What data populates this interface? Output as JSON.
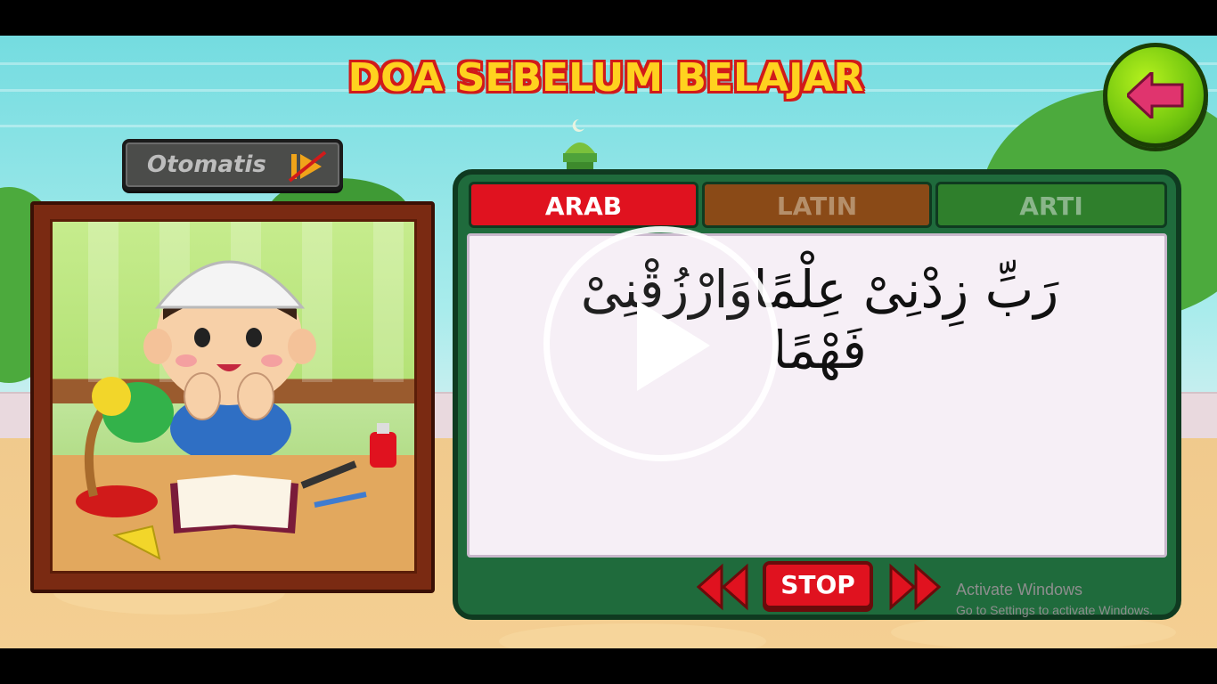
{
  "title": "DOA SEBELUM BELAJAR",
  "back_button": {
    "icon": "arrow-left-icon",
    "color": "#e0346e"
  },
  "otomatis_button": {
    "label": "Otomatis",
    "icon": "auto-play-disabled-icon"
  },
  "tabs": [
    {
      "label": "ARAB",
      "active": true
    },
    {
      "label": "LATIN",
      "active": false
    },
    {
      "label": "ARTI",
      "active": false
    }
  ],
  "prayer_text": "رَبِّ زِدْنِىْ عِلْمًاوَارْزُقْنِىْ فَهْمًا",
  "controls": {
    "prev_icon": "rewind-icon",
    "stop_label": "STOP",
    "next_icon": "fast-forward-icon"
  },
  "video_overlay": {
    "icon": "play-icon"
  },
  "watermark": {
    "title": "Activate Windows",
    "subtitle": "Go to Settings to activate Windows."
  },
  "colors": {
    "title_fill": "#ffd21f",
    "title_outline": "#d11a1a",
    "tab_arab": "#e0121f",
    "tab_latin": "#8a4a17",
    "tab_arti": "#2f7f2c",
    "panel": "#1f6b3c"
  }
}
